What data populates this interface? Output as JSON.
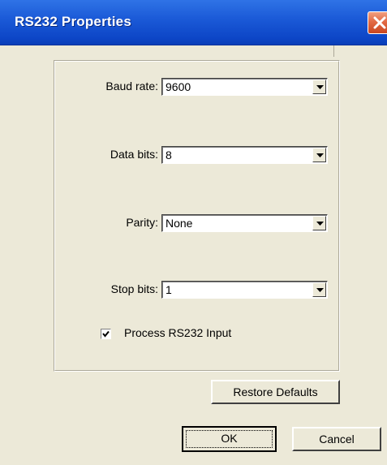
{
  "window": {
    "title": "RS232 Properties",
    "close_icon": "close-icon",
    "accent_color": "#0d46c7",
    "close_color": "#e26a45"
  },
  "fields": [
    {
      "label": "Baud rate:",
      "value": "9600"
    },
    {
      "label": "Data bits:",
      "value": "8"
    },
    {
      "label": "Parity:",
      "value": "None"
    },
    {
      "label": "Stop bits:",
      "value": "1"
    }
  ],
  "process_input": {
    "label": "Process RS232 Input",
    "checked": true
  },
  "buttons": {
    "restore_defaults": "Restore Defaults",
    "ok": "OK",
    "cancel": "Cancel"
  }
}
